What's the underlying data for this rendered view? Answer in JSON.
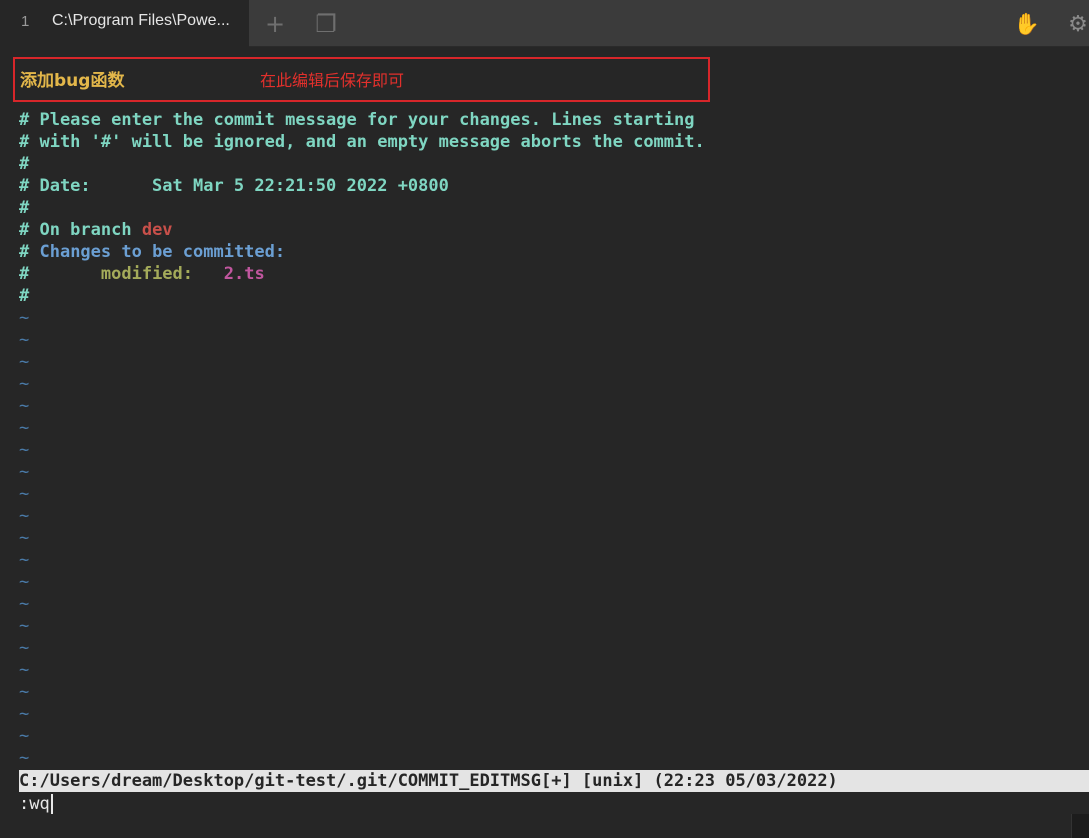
{
  "tabs": [
    {
      "number": "1",
      "title": "C:\\Program Files\\Powe..."
    }
  ],
  "toolbar": {
    "new_tab_glyph": "+",
    "overview_glyph": "❐",
    "hand_glyph": "✋",
    "settings_glyph": "⚙"
  },
  "annotation": {
    "commit_message": "添加bug函数",
    "note": "在此编辑后保存即可"
  },
  "comment_lines": {
    "l1": "# Please enter the commit message for your changes. Lines starting",
    "l2": "# with '#' will be ignored, and an empty message aborts the commit.",
    "l3": "#",
    "l4": "# Date:      Sat Mar 5 22:21:50 2022 +0800",
    "l5": "#",
    "l6_prefix": "# On branch ",
    "branch": "dev",
    "l7_hash": "# ",
    "l7_text": "Changes to be committed:",
    "l8_hash": "#       ",
    "l8_status": "modified:",
    "l8_gap": "   ",
    "l8_file": "2.ts",
    "l9": "#"
  },
  "tilde": "~",
  "statusline": "C:/Users/dream/Desktop/git-test/.git/COMMIT_EDITMSG[+] [unix] (22:23 05/03/2022)",
  "cmdline": ":wq",
  "colors": {
    "comment": "#7fd6c2",
    "branch": "#c8504a",
    "section": "#6b9fd3",
    "status": "#a4ab5a",
    "file": "#c0569e",
    "annotation_border": "#d7262a",
    "commit_text": "#e3b74a"
  }
}
